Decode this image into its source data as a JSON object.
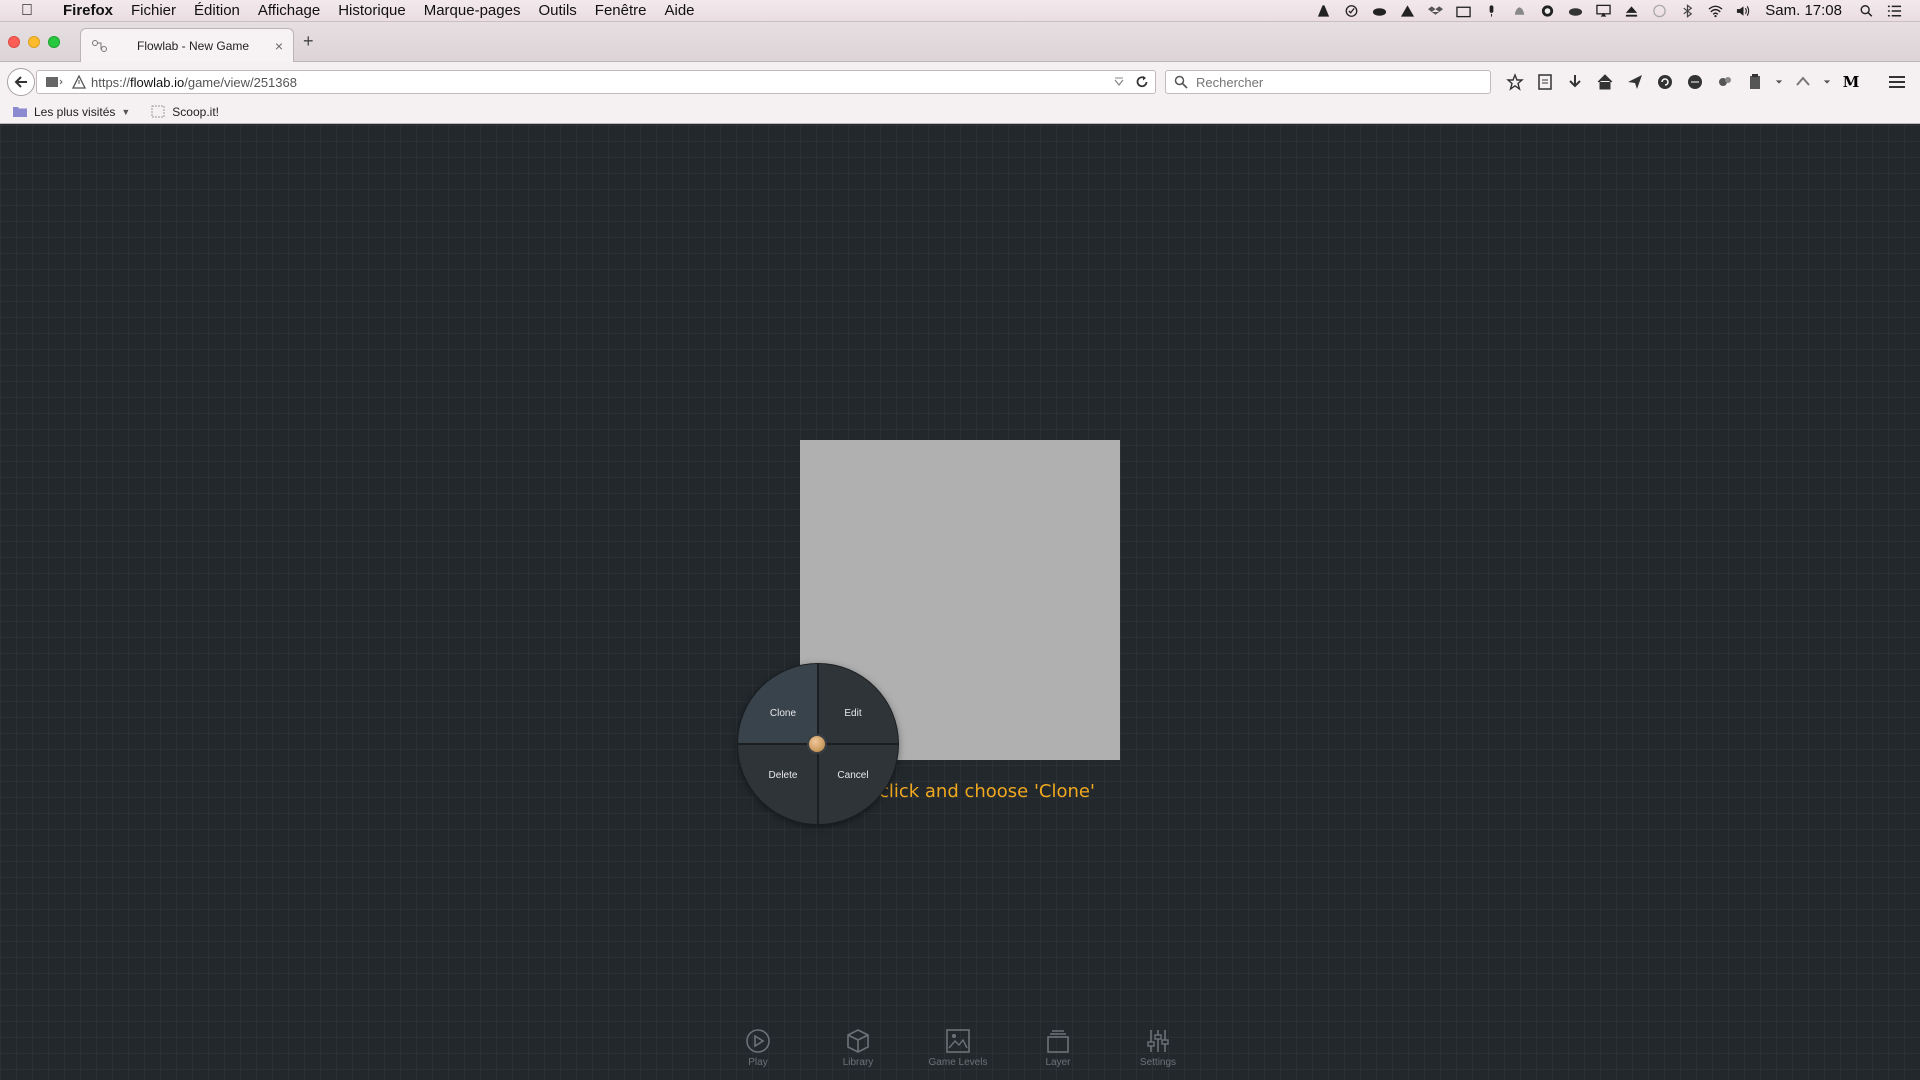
{
  "os_menubar": {
    "app_name": "Firefox",
    "menus": [
      "Fichier",
      "Édition",
      "Affichage",
      "Historique",
      "Marque-pages",
      "Outils",
      "Fenêtre",
      "Aide"
    ],
    "clock": "Sam. 17:08"
  },
  "browser": {
    "tab_title": "Flowlab - New Game",
    "url_prefix": "https://",
    "url_host": "flowlab.io",
    "url_path": "/game/view/251368",
    "search_placeholder": "Rechercher",
    "bookmarks": [
      {
        "label": "Les plus visités"
      },
      {
        "label": "Scoop.it!"
      }
    ]
  },
  "game": {
    "instruction_text": "Right-click and choose 'Clone'",
    "radial_menu": {
      "clone": "Clone",
      "edit": "Edit",
      "delete": "Delete",
      "cancel": "Cancel"
    },
    "bottom_toolbar": [
      "Play",
      "Library",
      "Game Levels",
      "Layer",
      "Settings"
    ]
  },
  "colors": {
    "canvas_bg": "#22282c",
    "object_fill": "#b0b0b0",
    "instruction": "#f0a81e",
    "radial_highlight": "#39434c"
  }
}
